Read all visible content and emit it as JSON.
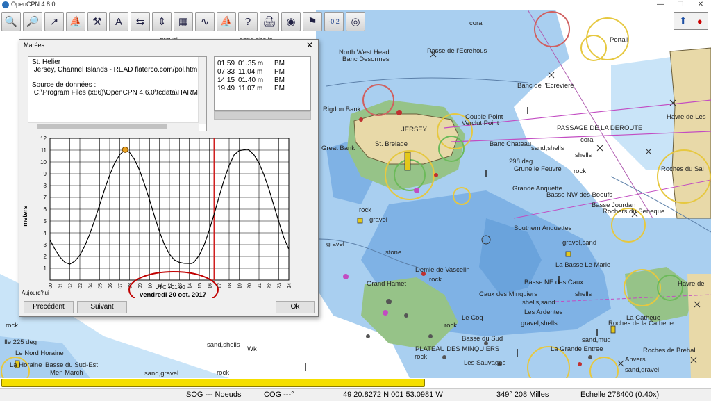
{
  "window": {
    "title": "OpenCPN 4.8.0"
  },
  "toolbar": {
    "buttons": [
      {
        "name": "zoom-in",
        "glyph": "🔍"
      },
      {
        "name": "zoom-out",
        "glyph": "🔎"
      },
      {
        "name": "route",
        "glyph": "↗"
      },
      {
        "name": "auto-follow",
        "glyph": "⛵"
      },
      {
        "name": "settings",
        "glyph": "⚒"
      },
      {
        "name": "text",
        "glyph": "A"
      },
      {
        "name": "quilt",
        "glyph": "⇆"
      },
      {
        "name": "scale",
        "glyph": "⇕"
      },
      {
        "name": "route-manager",
        "glyph": "▦"
      },
      {
        "name": "track",
        "glyph": "∿"
      },
      {
        "name": "ais",
        "glyph": "⛵"
      },
      {
        "name": "help",
        "glyph": "?"
      },
      {
        "name": "print",
        "glyph": "🖨"
      },
      {
        "name": "layers",
        "glyph": "◉"
      },
      {
        "name": "currents",
        "glyph": "⚑"
      },
      {
        "name": "tides",
        "glyph": "-0.2"
      },
      {
        "name": "mob",
        "glyph": "◎"
      }
    ]
  },
  "dialog": {
    "title": "Marées",
    "station_lines": [
      "St. Helier",
      " Jersey, Channel Islands - READ flaterco.com/pol.htm",
      "",
      "Source de données :",
      " C:\\Program Files (x86)\\OpenCPN 4.6.0\\tcdata\\HARM"
    ],
    "times": [
      {
        "time": "01:59",
        "height": "01.35 m",
        "type": "BM"
      },
      {
        "time": "07:33",
        "height": "11.04 m",
        "type": "PM"
      },
      {
        "time": "14:15",
        "height": "01.40 m",
        "type": "BM"
      },
      {
        "time": "19:49",
        "height": "11.07 m",
        "type": "PM"
      }
    ],
    "buttons": {
      "previous": "Precédent",
      "next": "Suivant",
      "ok": "Ok"
    },
    "today_label": "Aujourd'hui",
    "utc_label": "UTC +01:00",
    "date_label": "vendredi 20 oct. 2017",
    "annotation_color": "#c00000"
  },
  "chart_data": {
    "type": "line",
    "ylabel": "meters",
    "xlabel": "",
    "x_ticks": [
      "00",
      "01",
      "02",
      "03",
      "04",
      "05",
      "06",
      "07",
      "08",
      "09",
      "10",
      "11",
      "12",
      "13",
      "14",
      "15",
      "16",
      "17",
      "18",
      "19",
      "20",
      "21",
      "22",
      "23",
      "24"
    ],
    "y_ticks": [
      "1",
      "2",
      "3",
      "4",
      "5",
      "6",
      "7",
      "8",
      "9",
      "10",
      "11",
      "12"
    ],
    "xlim": [
      0,
      24
    ],
    "ylim": [
      0,
      12
    ],
    "series": [
      {
        "x": [
          0,
          0.5,
          1,
          1.5,
          1.98,
          2.5,
          3,
          3.5,
          4,
          4.5,
          5,
          5.5,
          6,
          6.5,
          7,
          7.55,
          8,
          8.5,
          9,
          9.5,
          10,
          10.5,
          11,
          11.5,
          12,
          12.5,
          13,
          13.5,
          14.25,
          14.5,
          15,
          15.5,
          16,
          16.5,
          17,
          17.5,
          18,
          18.5,
          19,
          19.82,
          20,
          20.5,
          21,
          21.5,
          22,
          22.5,
          23,
          23.5,
          24
        ],
        "y": [
          3.4,
          2.6,
          1.95,
          1.5,
          1.35,
          1.6,
          2.1,
          2.9,
          3.9,
          5.1,
          6.4,
          7.7,
          8.9,
          9.9,
          10.6,
          11.04,
          10.8,
          10.2,
          9.3,
          8.1,
          6.8,
          5.4,
          4.1,
          3.0,
          2.2,
          1.7,
          1.5,
          1.42,
          1.4,
          1.55,
          2.1,
          3.0,
          4.2,
          5.6,
          7.1,
          8.5,
          9.7,
          10.6,
          10.95,
          11.07,
          11.0,
          10.6,
          9.9,
          8.9,
          7.7,
          6.3,
          4.9,
          3.6,
          2.6
        ]
      }
    ],
    "current_time_hour": 7.55,
    "now_line_hour": 16.5,
    "colors": {
      "curve": "#000000",
      "now_line": "#d02020",
      "marker": "#e8a020"
    }
  },
  "map_labels": [
    {
      "t": "Passe de l'Ecrehous",
      "x": 615,
      "y": 68
    },
    {
      "t": "Banc Desormes",
      "x": 493,
      "y": 80
    },
    {
      "t": "gravel",
      "x": 230,
      "y": 52
    },
    {
      "t": "sand,shells",
      "x": 345,
      "y": 52
    },
    {
      "t": "Portail",
      "x": 878,
      "y": 52
    },
    {
      "t": "coral",
      "x": 676,
      "y": 28
    },
    {
      "t": "North West Head",
      "x": 488,
      "y": 70
    },
    {
      "t": "Banc de l'Ecreviere",
      "x": 745,
      "y": 118
    },
    {
      "t": "Havre de Les",
      "x": 960,
      "y": 163
    },
    {
      "t": "Rigdon Bank",
      "x": 465,
      "y": 152
    },
    {
      "t": "JERSEY",
      "x": 578,
      "y": 181
    },
    {
      "t": "Verclut Point",
      "x": 665,
      "y": 172
    },
    {
      "t": "Couple Point",
      "x": 670,
      "y": 163
    },
    {
      "t": "PASSAGE DE LA DEROUTE",
      "x": 802,
      "y": 179
    },
    {
      "t": "coral",
      "x": 836,
      "y": 196
    },
    {
      "t": "Great Bank",
      "x": 463,
      "y": 208
    },
    {
      "t": "St. Brelade",
      "x": 540,
      "y": 202
    },
    {
      "t": "Banc Chateau",
      "x": 705,
      "y": 202
    },
    {
      "t": "sand,shells",
      "x": 765,
      "y": 208
    },
    {
      "t": "shells",
      "x": 828,
      "y": 218
    },
    {
      "t": "298 deg",
      "x": 733,
      "y": 227
    },
    {
      "t": "Grune le Feuvre",
      "x": 740,
      "y": 238
    },
    {
      "t": "rock",
      "x": 826,
      "y": 241
    },
    {
      "t": "Roches du Sai",
      "x": 952,
      "y": 238
    },
    {
      "t": "Grande Anquette",
      "x": 738,
      "y": 266
    },
    {
      "t": "Basse NW des Boeufs",
      "x": 787,
      "y": 275
    },
    {
      "t": "Basse Jourdan",
      "x": 852,
      "y": 290
    },
    {
      "t": "Rochers du Seneque",
      "x": 868,
      "y": 299
    },
    {
      "t": "rock",
      "x": 517,
      "y": 297
    },
    {
      "t": "gravel",
      "x": 532,
      "y": 311
    },
    {
      "t": "Southern Anquettes",
      "x": 740,
      "y": 323
    },
    {
      "t": "gravel",
      "x": 470,
      "y": 346
    },
    {
      "t": "stone",
      "x": 555,
      "y": 358
    },
    {
      "t": "gravel,sand",
      "x": 810,
      "y": 344
    },
    {
      "t": "La Basse Le Marie",
      "x": 800,
      "y": 376
    },
    {
      "t": "Demie de Vascelin",
      "x": 598,
      "y": 383
    },
    {
      "t": "rock",
      "x": 618,
      "y": 397
    },
    {
      "t": "Basse NE des Caux",
      "x": 755,
      "y": 401
    },
    {
      "t": "Havre de",
      "x": 976,
      "y": 403
    },
    {
      "t": "Grand Hamet",
      "x": 528,
      "y": 403
    },
    {
      "t": "Caux des Minquiers",
      "x": 690,
      "y": 418
    },
    {
      "t": "shells",
      "x": 828,
      "y": 418
    },
    {
      "t": "shells,sand",
      "x": 752,
      "y": 430
    },
    {
      "t": "Les Ardentes",
      "x": 755,
      "y": 444
    },
    {
      "t": "La Catheue",
      "x": 902,
      "y": 452
    },
    {
      "t": "gravel,shells",
      "x": 750,
      "y": 460
    },
    {
      "t": "Le Coq",
      "x": 665,
      "y": 452
    },
    {
      "t": "rock",
      "x": 640,
      "y": 463
    },
    {
      "t": "rock",
      "x": 8,
      "y": 463
    },
    {
      "t": "Roches de la Catheue",
      "x": 876,
      "y": 460
    },
    {
      "t": "Basse du Sud",
      "x": 665,
      "y": 482
    },
    {
      "t": "sand,mud",
      "x": 838,
      "y": 484
    },
    {
      "t": "PLATEAU DES MINQUIERS",
      "x": 598,
      "y": 497
    },
    {
      "t": "La Grande Entree",
      "x": 793,
      "y": 497
    },
    {
      "t": "Roches de Brehal",
      "x": 926,
      "y": 499
    },
    {
      "t": "Ile 225 deg",
      "x": 6,
      "y": 487
    },
    {
      "t": "Le Nord Horaine",
      "x": 22,
      "y": 503
    },
    {
      "t": "sand,shells",
      "x": 298,
      "y": 491
    },
    {
      "t": "Wk",
      "x": 356,
      "y": 497
    },
    {
      "t": "La Horaine",
      "x": 14,
      "y": 520
    },
    {
      "t": "Basse du Sud-Est",
      "x": 65,
      "y": 520
    },
    {
      "t": "Men March",
      "x": 72,
      "y": 531
    },
    {
      "t": "sand,gravel",
      "x": 208,
      "y": 532
    },
    {
      "t": "rock",
      "x": 597,
      "y": 508
    },
    {
      "t": "Les Sauvages",
      "x": 668,
      "y": 517
    },
    {
      "t": "Anvers",
      "x": 900,
      "y": 512
    },
    {
      "t": "rock",
      "x": 312,
      "y": 531
    },
    {
      "t": "sand,gravel",
      "x": 900,
      "y": 527
    }
  ],
  "status": {
    "sog": "SOG --- Noeuds",
    "cog": "COG ---°",
    "position": "49 20.8272 N   001 53.0981 W",
    "bearing": "349°  208 Milles",
    "scale": "Echelle 278400 (0.40x)"
  }
}
